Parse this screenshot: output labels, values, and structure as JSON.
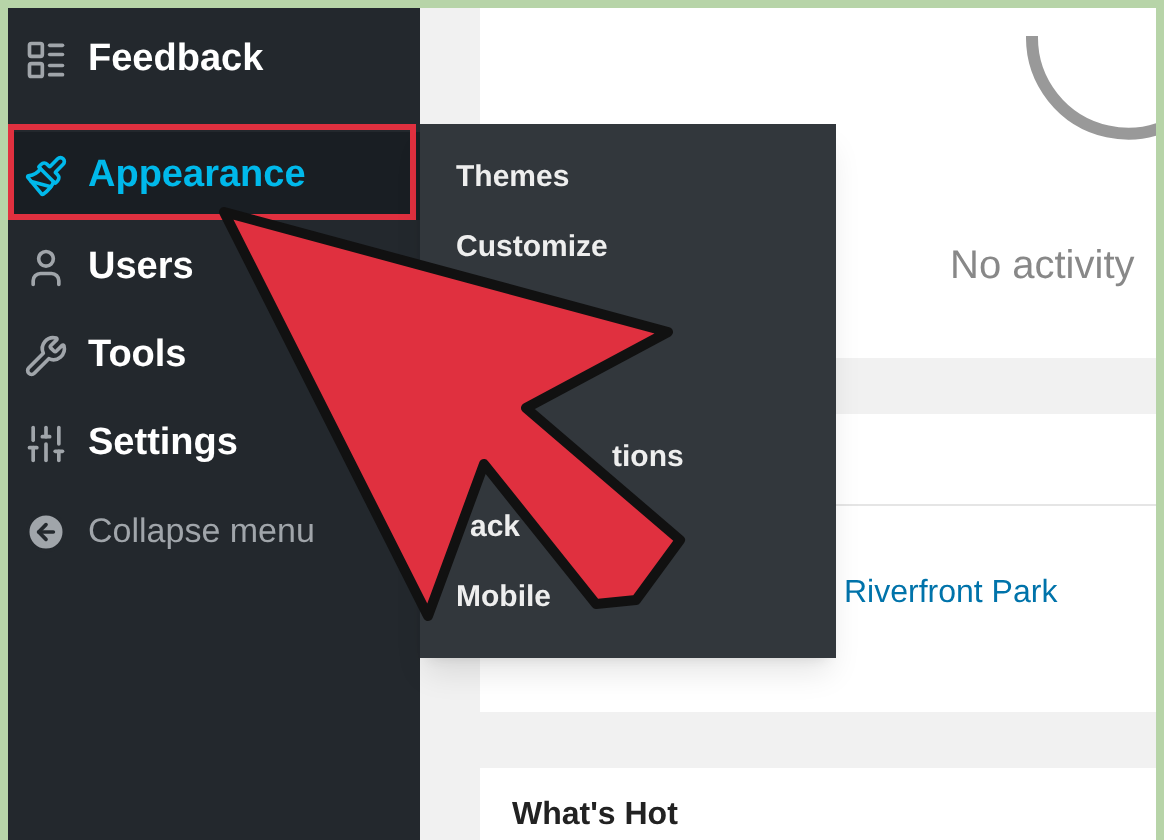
{
  "sidebar": {
    "items": [
      {
        "label": "Feedback",
        "selected": false
      },
      {
        "label": "Appearance",
        "selected": true
      },
      {
        "label": "Users",
        "selected": false
      },
      {
        "label": "Tools",
        "selected": false
      },
      {
        "label": "Settings",
        "selected": false
      }
    ],
    "collapse": "Collapse menu"
  },
  "submenu": {
    "items": [
      {
        "label": "Themes",
        "kind": "full"
      },
      {
        "label": "Customize",
        "kind": "full"
      },
      {
        "label": "tions",
        "kind": "covered-left"
      },
      {
        "label": "ack",
        "kind": "covered-both"
      },
      {
        "label": "Mobile",
        "kind": "full"
      }
    ]
  },
  "activity": {
    "message": "No activity"
  },
  "events": {
    "link": "Riverfront Park"
  },
  "whats_hot": {
    "title": "What's Hot"
  }
}
